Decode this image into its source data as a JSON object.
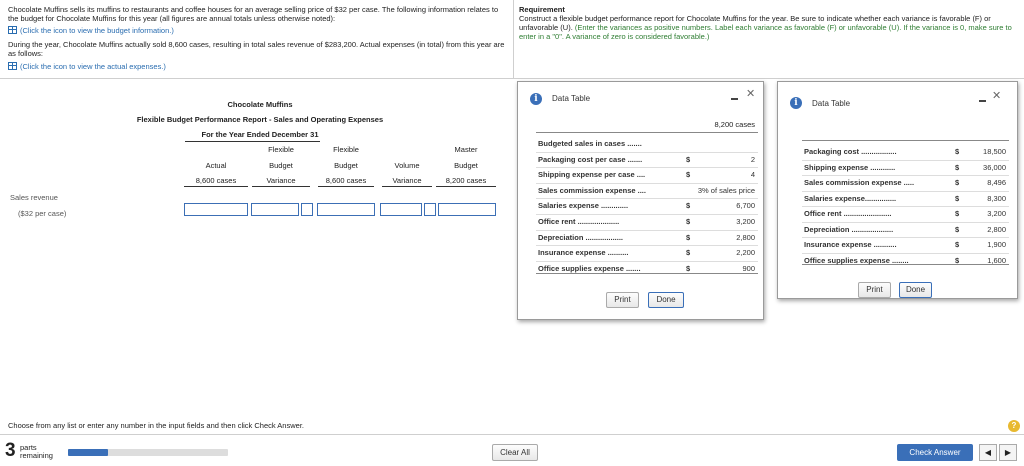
{
  "problem": {
    "text1": "Chocolate Muffins sells its muffins to restaurants and coffee houses for an average selling price of $32 per case. The following information relates to the budget for Chocolate Muffins for this year (all figures are annual totals unless otherwise noted):",
    "link1": "(Click the icon to view the budget information.)",
    "text2": "During the year, Chocolate Muffins actually sold 8,600 cases, resulting in total sales revenue of $283,200. Actual expenses (in total) from this year are as follows:",
    "link2": "(Click the icon to view the actual expenses.)"
  },
  "requirement": {
    "heading": "Requirement",
    "text": "Construct a flexible budget performance report for Chocolate Muffins for the year. Be sure to indicate whether each variance is favorable (F) or unfavorable (U).",
    "note": "(Enter the variances as positive numbers. Label each variance as favorable (F) or unfavorable (U). If the variance is 0, make sure to enter in a \"0\". A variance of zero is considered favorable.)"
  },
  "report": {
    "company": "Chocolate Muffins",
    "title": "Flexible Budget Performance Report - Sales and Operating Expenses",
    "period": "For the Year Ended December 31",
    "columns": [
      {
        "l1": "",
        "l2": "Actual",
        "l3": "8,600 cases"
      },
      {
        "l1": "Flexible",
        "l2": "Budget",
        "l3": "Variance"
      },
      {
        "l1": "Flexible",
        "l2": "Budget",
        "l3": "8,600 cases"
      },
      {
        "l1": "",
        "l2": "Volume",
        "l3": "Variance"
      },
      {
        "l1": "Master",
        "l2": "Budget",
        "l3": "8,200 cases"
      }
    ],
    "row_label": "Sales revenue",
    "row_sub": "($32 per case)"
  },
  "dialog1": {
    "title": "Data Table",
    "header_value": "8,200 cases",
    "rows": [
      {
        "label": "Budgeted sales in cases .......",
        "cur": "",
        "value": "8,200 cases"
      },
      {
        "label": "Packaging cost per case .......",
        "cur": "$",
        "value": "2"
      },
      {
        "label": "Shipping expense per case ....",
        "cur": "$",
        "value": "4"
      },
      {
        "label": "Sales commission expense ....",
        "cur": "",
        "value": "3% of sales price"
      },
      {
        "label": "Salaries expense .............",
        "cur": "$",
        "value": "6,700"
      },
      {
        "label": "Office rent ....................",
        "cur": "$",
        "value": "3,200"
      },
      {
        "label": "Depreciation ..................",
        "cur": "$",
        "value": "2,800"
      },
      {
        "label": "Insurance expense ..........",
        "cur": "$",
        "value": "2,200"
      },
      {
        "label": "Office supplies expense .......",
        "cur": "$",
        "value": "900"
      }
    ],
    "print": "Print",
    "done": "Done"
  },
  "dialog2": {
    "title": "Data Table",
    "rows": [
      {
        "label": "Packaging cost .................",
        "cur": "$",
        "value": "18,500"
      },
      {
        "label": "Shipping expense ............",
        "cur": "$",
        "value": "36,000"
      },
      {
        "label": "Sales commission expense .....",
        "cur": "$",
        "value": "8,496"
      },
      {
        "label": "Salaries expense...............",
        "cur": "$",
        "value": "8,300"
      },
      {
        "label": "Office rent .......................",
        "cur": "$",
        "value": "3,200"
      },
      {
        "label": "Depreciation ....................",
        "cur": "$",
        "value": "2,800"
      },
      {
        "label": "Insurance expense ...........",
        "cur": "$",
        "value": "1,900"
      },
      {
        "label": "Office supplies expense ........",
        "cur": "$",
        "value": "1,600"
      }
    ],
    "print": "Print",
    "done": "Done"
  },
  "footer": {
    "instruction": "Choose from any list or enter any number in the input fields and then click Check Answer.",
    "parts_num": "3",
    "parts_l1": "parts",
    "parts_l2": "remaining",
    "clear_all": "Clear All",
    "check_answer": "Check Answer",
    "help": "?"
  },
  "colors": {
    "accent": "#3a6fb8",
    "link": "#2a6db0",
    "progress": "#3a6fb8"
  },
  "progress_fraction": 0.25
}
